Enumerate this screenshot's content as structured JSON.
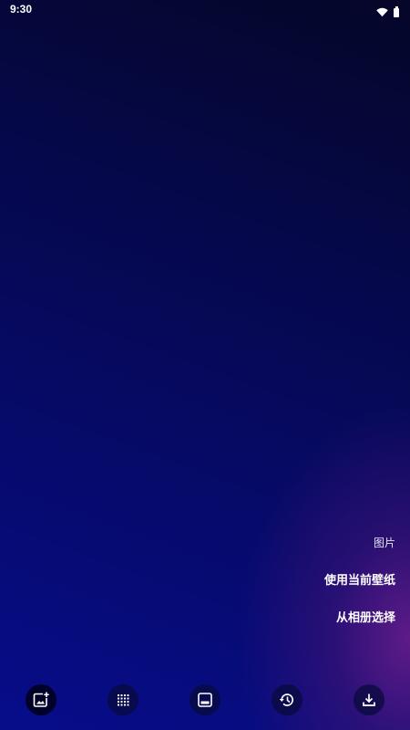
{
  "status_bar": {
    "time": "9:30",
    "icons": [
      "wifi-icon",
      "battery-icon"
    ]
  },
  "menu": {
    "items": [
      {
        "label": "图片"
      },
      {
        "label": "使用当前壁纸"
      },
      {
        "label": "从相册选择"
      }
    ]
  },
  "toolbar": {
    "buttons": [
      {
        "icon": "add-image-icon",
        "active": true
      },
      {
        "icon": "grid-icon",
        "active": false
      },
      {
        "icon": "panel-icon",
        "active": false
      },
      {
        "icon": "history-icon",
        "active": false
      },
      {
        "icon": "download-icon",
        "active": false
      }
    ]
  },
  "colors": {
    "background_top": "#050628",
    "background_bottom": "#070d8a",
    "accent_glow": "#6e1e8c",
    "text": "#ffffff"
  }
}
